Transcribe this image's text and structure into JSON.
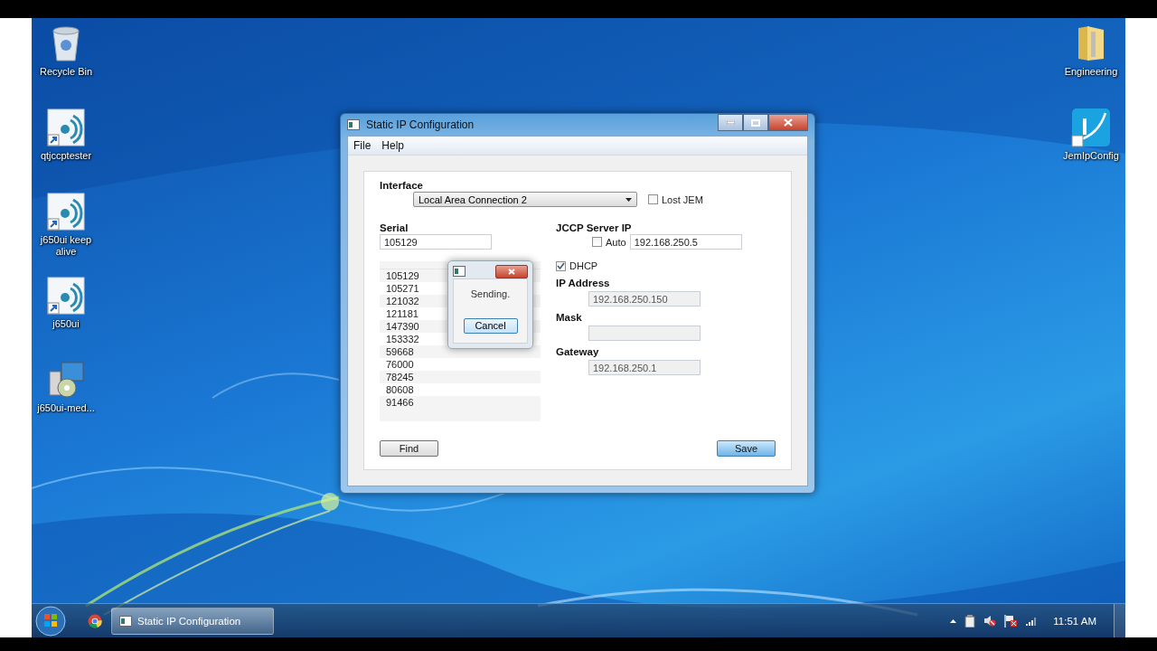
{
  "desktop_icons_left": [
    {
      "label": "Recycle Bin",
      "kind": "recycle-bin"
    },
    {
      "label": "qtjccptester",
      "kind": "shortcut"
    },
    {
      "label": "j650ui keep alive",
      "kind": "shortcut"
    },
    {
      "label": "j650ui",
      "kind": "shortcut"
    },
    {
      "label": "j650ui-med...",
      "kind": "installer"
    }
  ],
  "desktop_icons_right": [
    {
      "label": "Engineering",
      "kind": "folder"
    },
    {
      "label": "JemIpConfig",
      "kind": "ip-config"
    }
  ],
  "window": {
    "title": "Static IP Configuration",
    "menu": [
      "File",
      "Help"
    ],
    "interface": {
      "label": "Interface",
      "value": "Local Area Connection 2"
    },
    "lost_jem": {
      "label": "Lost JEM",
      "checked": false
    },
    "serial": {
      "label": "Serial",
      "value": "105129"
    },
    "serial_list": [
      "105129",
      "105271",
      "121032",
      "121181",
      "147390",
      "153332",
      "59668",
      "76000",
      "78245",
      "80608",
      "91466"
    ],
    "jccp": {
      "label": "JCCP Server IP",
      "auto": {
        "label": "Auto",
        "checked": false
      },
      "value": "192.168.250.5"
    },
    "dhcp": {
      "label": "DHCP",
      "checked": true
    },
    "ip": {
      "label": "IP Address",
      "value": "192.168.250.150",
      "disabled": true
    },
    "mask": {
      "label": "Mask",
      "disabled": true
    },
    "gateway": {
      "label": "Gateway",
      "value": "192.168.250.1",
      "disabled": true
    },
    "find_button": "Find",
    "save_button": "Save"
  },
  "dialog": {
    "text": "Sending.",
    "cancel_button": "Cancel"
  },
  "taskbar": {
    "items": [
      {
        "label": "Static IP Configuration",
        "selected": true
      }
    ],
    "clock": "11:51 AM"
  }
}
